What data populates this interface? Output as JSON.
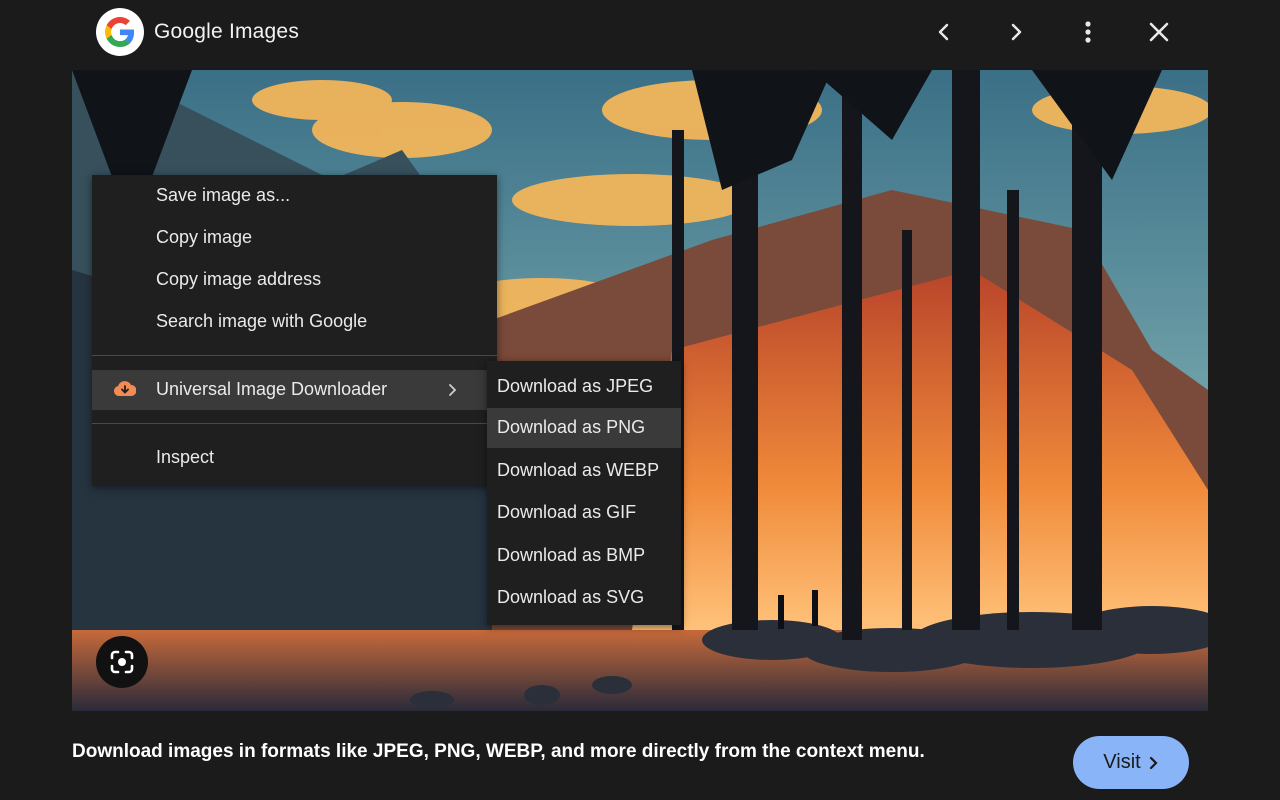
{
  "header": {
    "title": "Google Images"
  },
  "context_menu": {
    "items": [
      {
        "label": "Save image as..."
      },
      {
        "label": "Copy image"
      },
      {
        "label": "Copy image address"
      },
      {
        "label": "Search image with Google"
      }
    ],
    "extension_item": {
      "label": "Universal Image Downloader",
      "icon": "cloud-download-icon",
      "icon_color": "#f28b54"
    },
    "inspect_item": {
      "label": "Inspect"
    }
  },
  "submenu": {
    "items": [
      {
        "label": "Download as JPEG"
      },
      {
        "label": "Download as PNG"
      },
      {
        "label": "Download as WEBP"
      },
      {
        "label": "Download as GIF"
      },
      {
        "label": "Download as BMP"
      },
      {
        "label": "Download as SVG"
      }
    ],
    "highlighted": "Download as PNG"
  },
  "footer": {
    "description": "Download images in formats like JPEG, PNG, WEBP, and more directly from the context menu.",
    "visit_label": "Visit"
  },
  "colors": {
    "background": "#1b1b1b",
    "menu_bg": "#1f1f1f",
    "highlight_bg": "#3a3a3a",
    "accent_button": "#8ab4f8"
  }
}
